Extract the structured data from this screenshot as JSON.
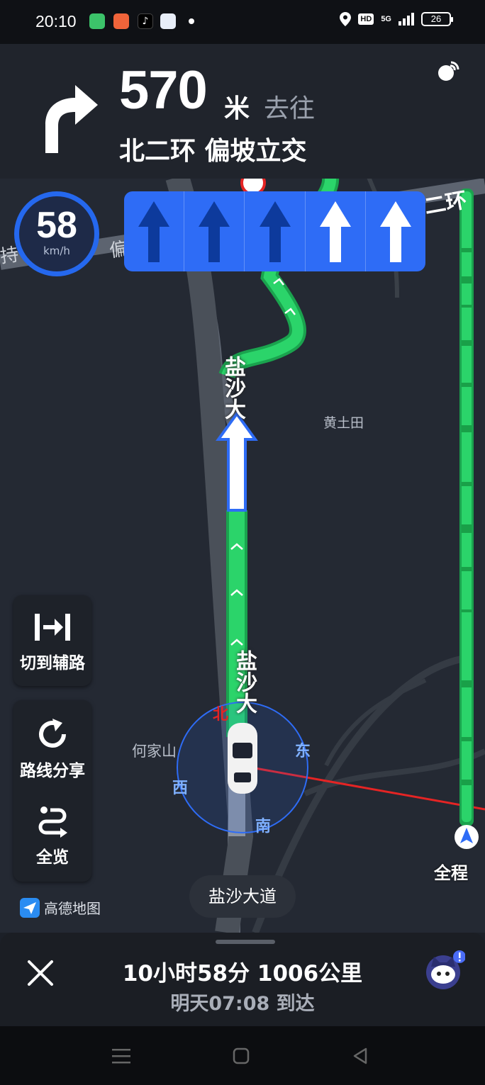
{
  "status": {
    "time": "20:10",
    "hd": "HD",
    "signal": "5G",
    "battery": "26"
  },
  "guidance": {
    "distance": "570",
    "unit": "米",
    "goto": "去往",
    "road": "北二环 偏坡立交"
  },
  "speed": {
    "value": "58",
    "unit": "km/h"
  },
  "map": {
    "poi_huangtutian": "黄土田",
    "poi_hejiashan": "何家山",
    "road_top_left_1": "持",
    "road_top_left_2": "偏",
    "road_top_right": "二环",
    "road_vertical_upper": "盐沙大",
    "road_vertical_lower": "盐沙大",
    "compass_n": "北",
    "compass_e": "东",
    "compass_w": "西",
    "compass_s": "南",
    "current_road": "盐沙大道",
    "overview_label": "全程"
  },
  "buttons": {
    "switch_aux": "切到辅路",
    "share_route": "路线分享",
    "overview": "全览"
  },
  "logo": "高德地图",
  "trip": {
    "summary": "10小时58分  1006公里",
    "arrival": "明天07:08 到达"
  },
  "colors": {
    "route_green": "#2bd46a",
    "lane_blue": "#2e6cf6",
    "lane_active": "#ffffff",
    "lane_inactive": "#0d3a9c"
  }
}
